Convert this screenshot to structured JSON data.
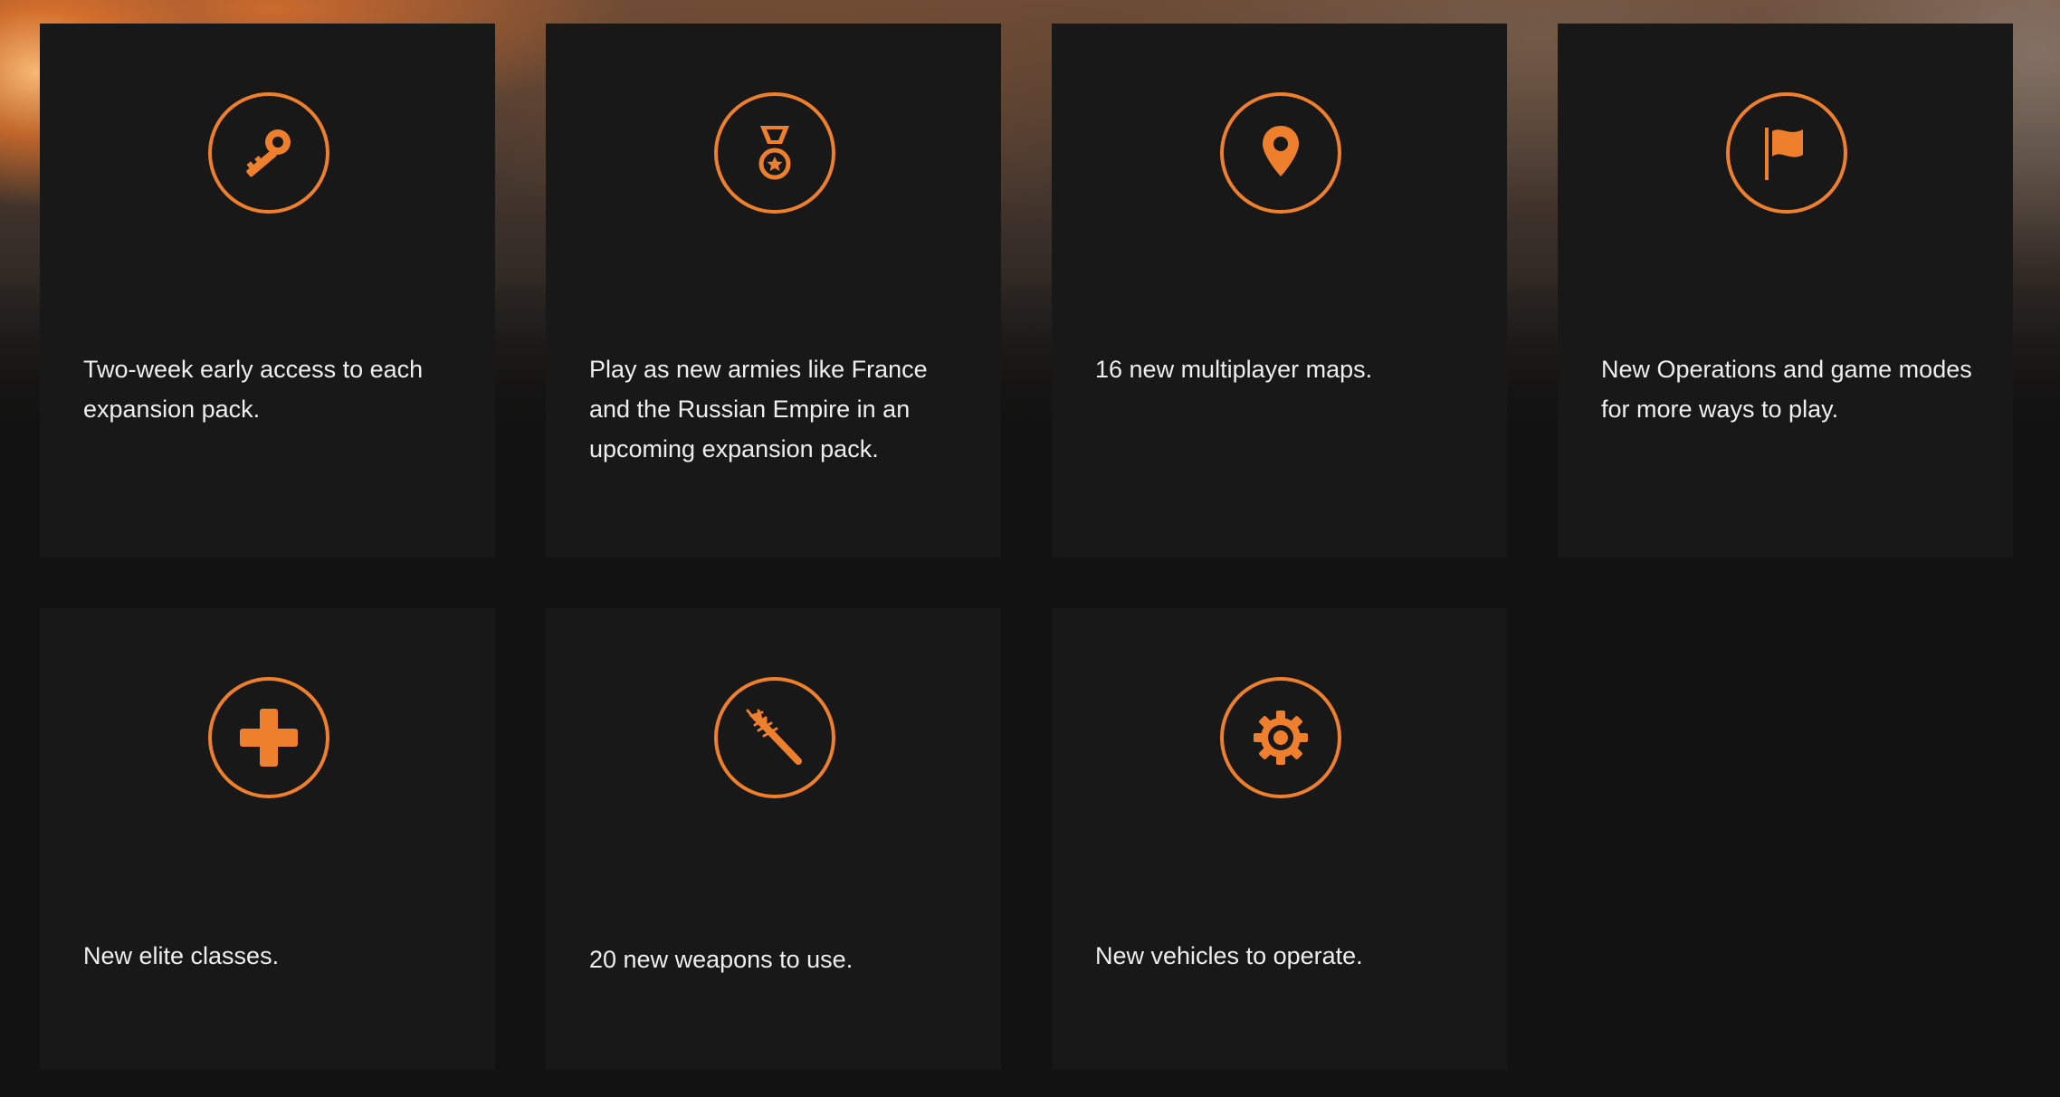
{
  "accent_color": "#ee7f2c",
  "features": [
    {
      "icon": "key-icon",
      "text": "Two-week early access to each expansion pack."
    },
    {
      "icon": "medal-icon",
      "text": "Play as new armies like France and the Russian Empire in an upcoming expansion pack."
    },
    {
      "icon": "map-pin-icon",
      "text": "16 new multiplayer maps."
    },
    {
      "icon": "flag-icon",
      "text": "New Operations and game modes for more ways to play."
    },
    {
      "icon": "plus-icon",
      "text": "New elite classes."
    },
    {
      "icon": "spiked-club-icon",
      "text": "20 new weapons to use."
    },
    {
      "icon": "gear-icon",
      "text": "New vehicles to operate."
    }
  ]
}
